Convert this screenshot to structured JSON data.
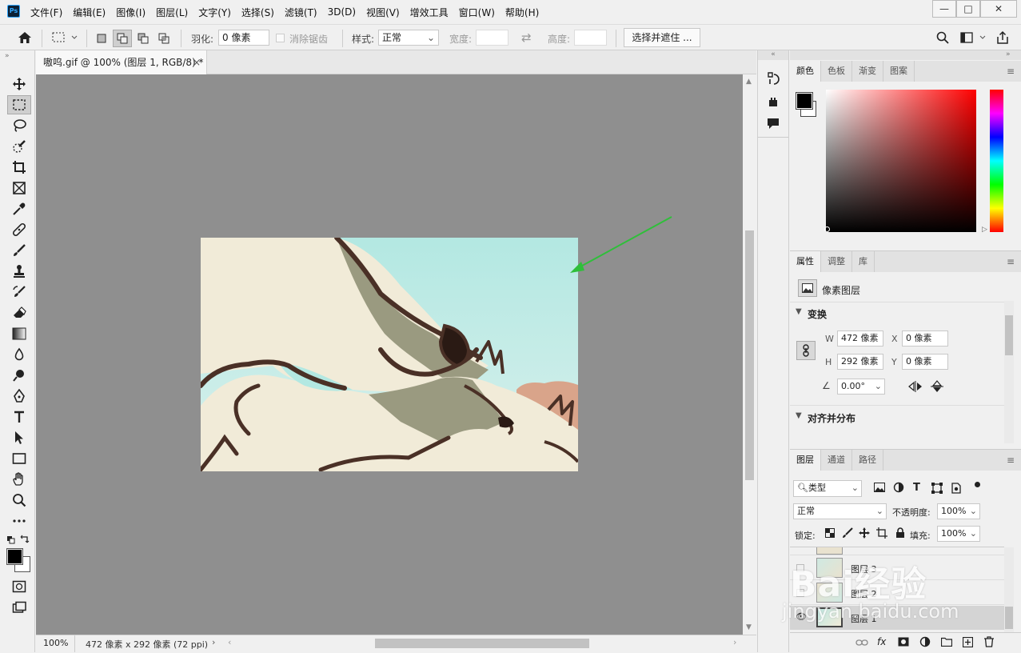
{
  "app": {
    "logo": "Ps"
  },
  "menu": [
    "文件(F)",
    "编辑(E)",
    "图像(I)",
    "图层(L)",
    "文字(Y)",
    "选择(S)",
    "滤镜(T)",
    "3D(D)",
    "视图(V)",
    "增效工具",
    "窗口(W)",
    "帮助(H)"
  ],
  "window": {
    "minimize": "—",
    "maximize": "□",
    "close": "✕"
  },
  "options": {
    "feather_label": "羽化:",
    "feather_value": "0 像素",
    "antialias_label": "消除锯齿",
    "style_label": "样式:",
    "style_value": "正常",
    "width_label": "宽度:",
    "height_label": "高度:",
    "select_mask": "选择并遮住 ..."
  },
  "document": {
    "tab_title": "嗷呜.gif @ 100% (图层 1, RGB/8) *",
    "close": "×",
    "zoom": "100%",
    "info": "472 像素 x 292 像素 (72 ppi)"
  },
  "color_panel": {
    "tabs": [
      "颜色",
      "色板",
      "渐变",
      "图案"
    ]
  },
  "properties_panel": {
    "tabs": [
      "属性",
      "调整",
      "库"
    ],
    "layer_type": "像素图层",
    "transform_title": "变换",
    "w_label": "W",
    "w_value": "472 像素",
    "h_label": "H",
    "h_value": "292 像素",
    "x_label": "X",
    "x_value": "0 像素",
    "y_label": "Y",
    "y_value": "0 像素",
    "angle_value": "0.00°",
    "align_title": "对齐并分布"
  },
  "layers_panel": {
    "tabs": [
      "图层",
      "通道",
      "路径"
    ],
    "filter_value": "类型",
    "blend_value": "正常",
    "opacity_label": "不透明度:",
    "opacity_value": "100%",
    "lock_label": "锁定:",
    "fill_label": "填充:",
    "fill_value": "100%",
    "layers": [
      "图层 3",
      "图层 2",
      "图层 1"
    ],
    "footer_fx": "fx"
  },
  "watermark": {
    "text": "Bai经验",
    "url": "jingyan.baidu.com"
  },
  "colors": {
    "accent_arrow": "#2fbf3a",
    "sky": "#a8e4e1",
    "fur": "#f1ebd8",
    "outline": "#4a3026",
    "shade": "#9a9a80",
    "rock": "#d9a48a"
  }
}
